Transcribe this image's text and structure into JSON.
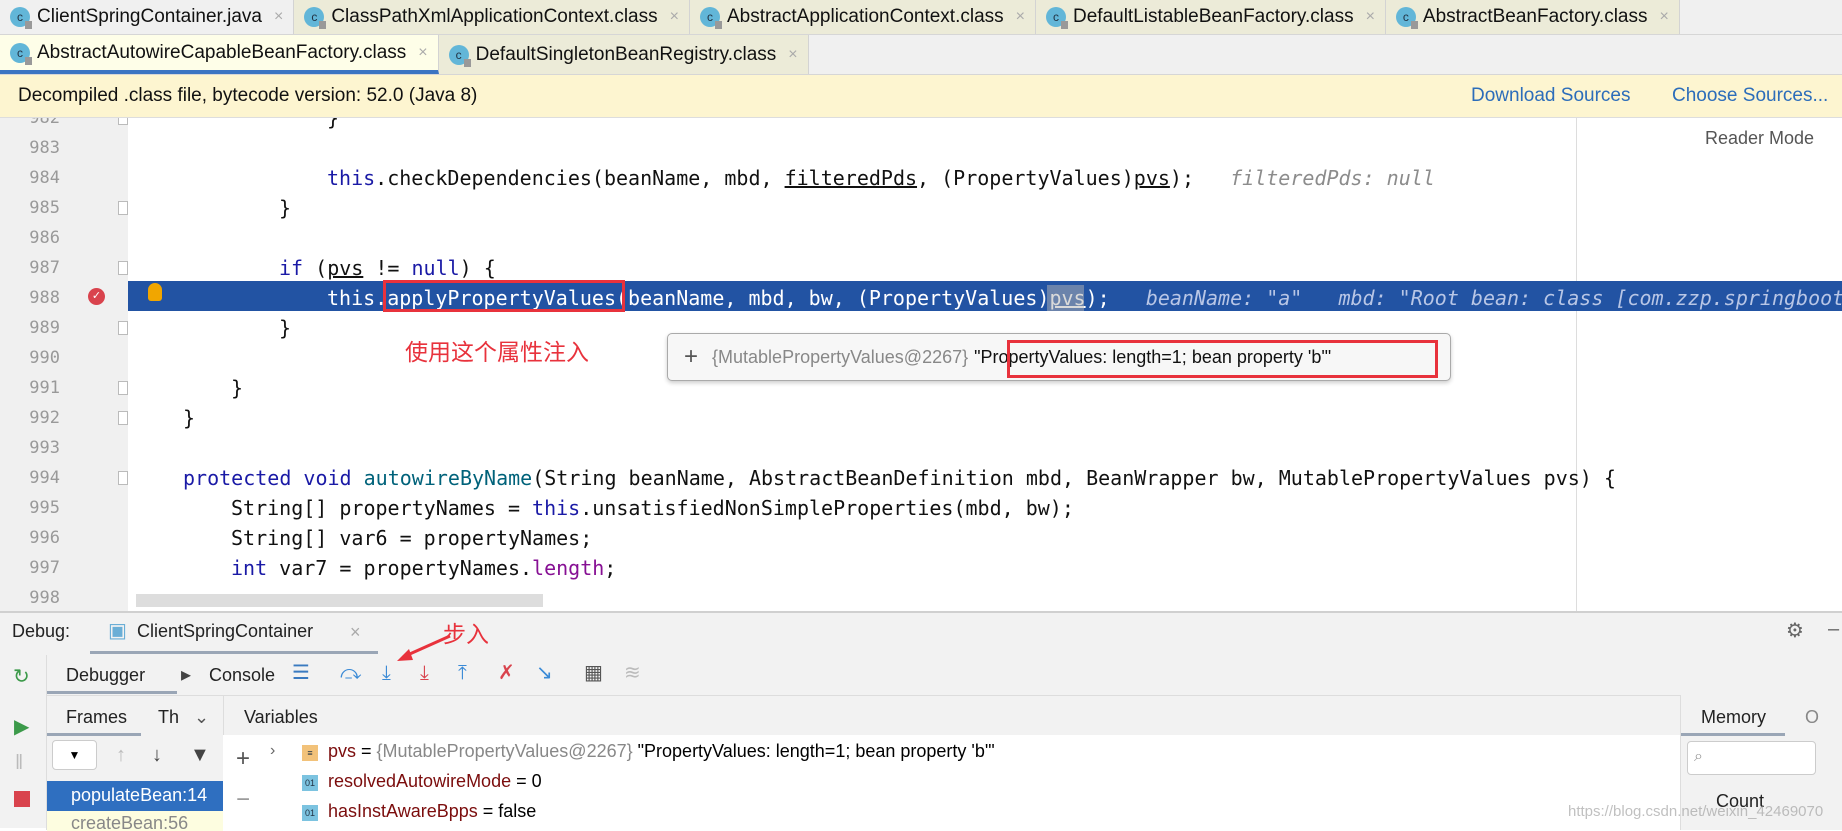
{
  "tabs_row1": [
    {
      "label": "ClientSpringContainer.java",
      "icon": "java-class-icon"
    },
    {
      "label": "ClassPathXmlApplicationContext.class",
      "icon": "class-icon"
    },
    {
      "label": "AbstractApplicationContext.class",
      "icon": "class-icon"
    },
    {
      "label": "DefaultListableBeanFactory.class",
      "icon": "class-icon"
    },
    {
      "label": "AbstractBeanFactory.class",
      "icon": "class-icon"
    }
  ],
  "tabs_row2": [
    {
      "label": "AbstractAutowireCapableBeanFactory.class",
      "icon": "class-icon",
      "active": true
    },
    {
      "label": "DefaultSingletonBeanRegistry.class",
      "icon": "class-icon"
    }
  ],
  "banner": {
    "text": "Decompiled .class file, bytecode version: 52.0 (Java 8)",
    "download": "Download Sources",
    "choose": "Choose Sources..."
  },
  "reader_mode": "Reader Mode",
  "code_lines": [
    {
      "n": "982",
      "indent": 4,
      "tokens": [
        [
          "txt",
          "}"
        ]
      ]
    },
    {
      "n": "983",
      "indent": 0,
      "tokens": []
    },
    {
      "n": "984",
      "indent": 4,
      "tokens": [
        [
          "kw",
          "this"
        ],
        [
          "txt",
          ".checkDependencies(beanName, mbd, "
        ],
        [
          "ul",
          "filteredPds"
        ],
        [
          "txt",
          ", (PropertyValues)"
        ],
        [
          "ul",
          "pvs"
        ],
        [
          "txt",
          ");   "
        ],
        [
          "hint",
          "filteredPds: null"
        ]
      ]
    },
    {
      "n": "985",
      "indent": 3,
      "tokens": [
        [
          "txt",
          "}"
        ]
      ]
    },
    {
      "n": "986",
      "indent": 0,
      "tokens": []
    },
    {
      "n": "987",
      "indent": 3,
      "tokens": [
        [
          "kw",
          "if"
        ],
        [
          "txt",
          " ("
        ],
        [
          "ul",
          "pvs"
        ],
        [
          "txt",
          " != "
        ],
        [
          "kw",
          "null"
        ],
        [
          "txt",
          ") {"
        ]
      ]
    },
    {
      "n": "988",
      "indent": 4,
      "hl": true,
      "tokens": [
        [
          "kw",
          "this"
        ],
        [
          "txt",
          ".applyPropertyValues(beanName, mbd, bw, (PropertyValues)"
        ],
        [
          "ul",
          "pvs"
        ],
        [
          "txt",
          ");   "
        ],
        [
          "hint",
          "beanName: \"a\"   mbd: \"Root bean: class [com.zzp.springboot"
        ]
      ]
    },
    {
      "n": "989",
      "indent": 3,
      "tokens": [
        [
          "txt",
          "}"
        ]
      ]
    },
    {
      "n": "990",
      "indent": 0,
      "tokens": []
    },
    {
      "n": "991",
      "indent": 2,
      "tokens": [
        [
          "txt",
          "}"
        ]
      ]
    },
    {
      "n": "992",
      "indent": 1,
      "tokens": [
        [
          "txt",
          "}"
        ]
      ]
    },
    {
      "n": "993",
      "indent": 0,
      "tokens": []
    },
    {
      "n": "994",
      "indent": 1,
      "tokens": [
        [
          "kw",
          "protected void "
        ],
        [
          "fn",
          "autowireByName"
        ],
        [
          "txt",
          "(String beanName, AbstractBeanDefinition mbd, BeanWrapper bw, MutablePropertyValues pvs) {"
        ]
      ]
    },
    {
      "n": "995",
      "indent": 2,
      "tokens": [
        [
          "txt",
          "String[] propertyNames = "
        ],
        [
          "kw",
          "this"
        ],
        [
          "txt",
          ".unsatisfiedNonSimpleProperties(mbd, bw);"
        ]
      ]
    },
    {
      "n": "996",
      "indent": 2,
      "tokens": [
        [
          "txt",
          "String[] var6 = propertyNames;"
        ]
      ]
    },
    {
      "n": "997",
      "indent": 2,
      "tokens": [
        [
          "kw",
          "int"
        ],
        [
          "txt",
          " var7 = propertyNames."
        ],
        [
          "fld",
          "length"
        ],
        [
          "txt",
          ";"
        ]
      ]
    },
    {
      "n": "998",
      "indent": 0,
      "tokens": []
    }
  ],
  "tooltip": {
    "object": "{MutablePropertyValues@2267}",
    "value": "\"PropertyValues: length=1; bean property 'b'\""
  },
  "annotations": {
    "inject": "使用这个属性注入",
    "step_into": "步入"
  },
  "debug": {
    "label": "Debug:",
    "session": "ClientSpringContainer",
    "tab_debugger": "Debugger",
    "tab_console": "Console",
    "frames": "Frames",
    "threads": "Th",
    "variables": "Variables",
    "memory": "Memory",
    "memory_more": "O",
    "frame_selected": "populateBean:14",
    "frame_next": "createBean:56",
    "count_col": "Count",
    "vars": [
      {
        "name": "pvs",
        "eq": " = ",
        "type": "{MutablePropertyValues@2267}",
        "value": " \"PropertyValues: length=1; bean property 'b'\"",
        "icon": "field-list-icon",
        "expandable": true
      },
      {
        "name": "resolvedAutowireMode",
        "eq": " = ",
        "value": "0",
        "icon": "primitive-icon"
      },
      {
        "name": "hasInstAwareBpps",
        "eq": " = ",
        "value": "false",
        "icon": "primitive-icon"
      }
    ]
  },
  "watermark": "https://blog.csdn.net/weixin_42469070",
  "colors": {
    "highlight": "#2253a3",
    "annotation": "#e8323c",
    "link": "#2c6dba",
    "banner": "#fdf5d0"
  }
}
